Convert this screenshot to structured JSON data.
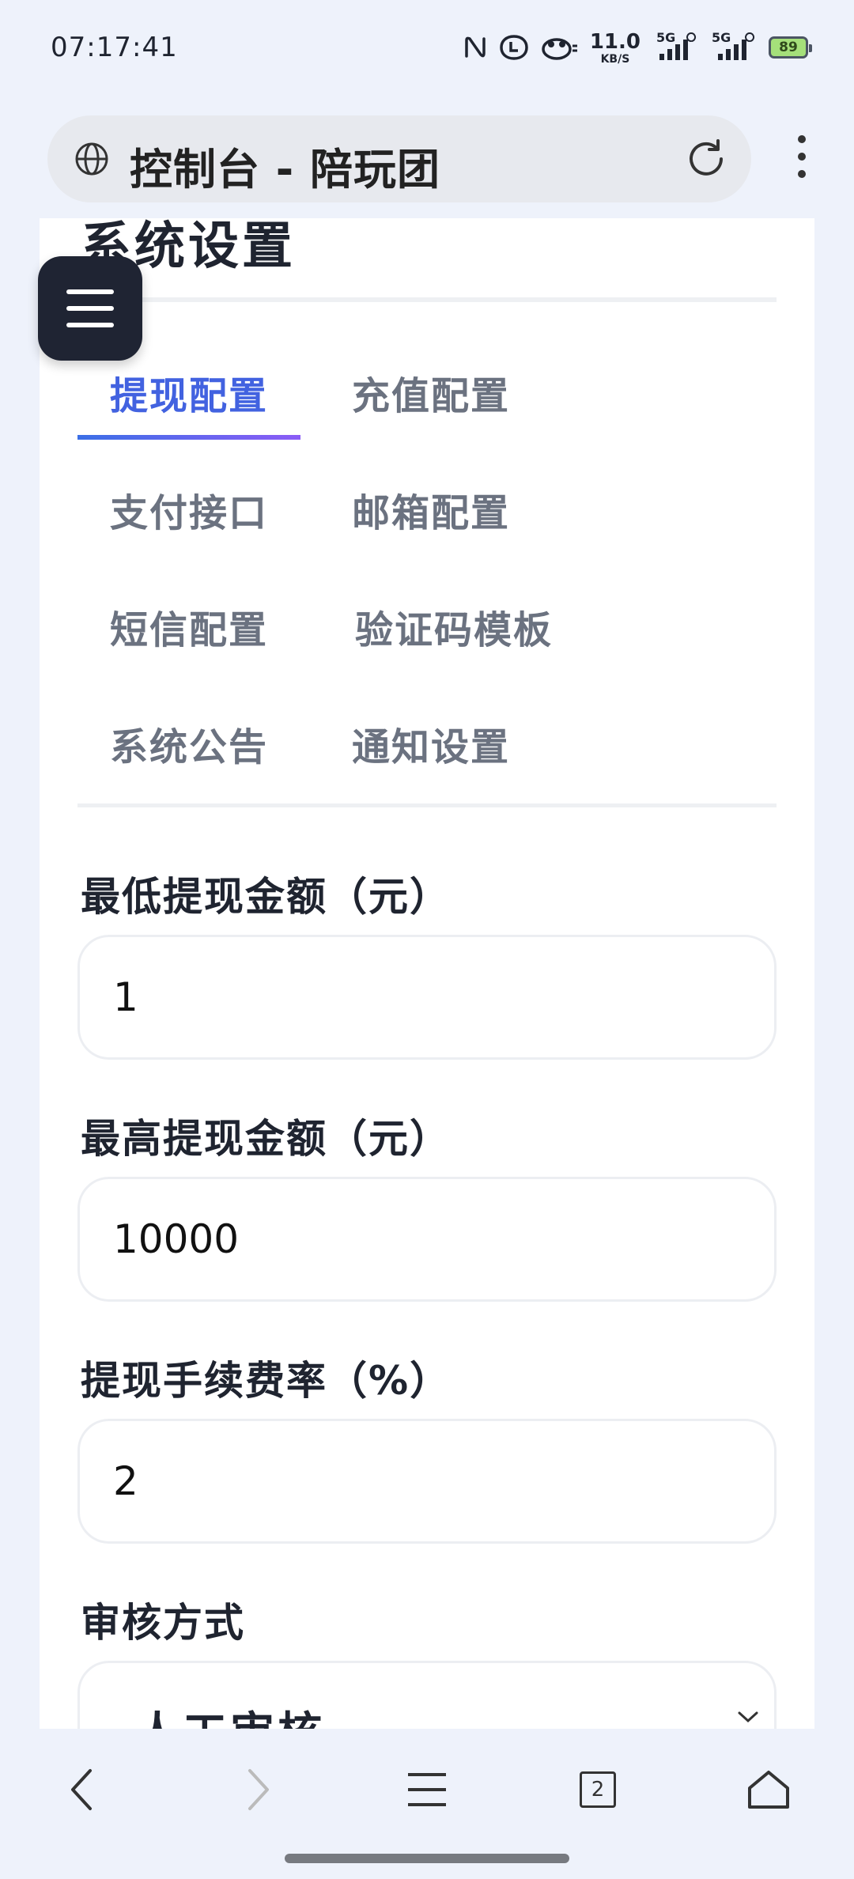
{
  "status_bar": {
    "time": "07:17:41",
    "net_speed_value": "11.0",
    "net_speed_unit": "KB/S",
    "net_type_1": "5G",
    "net_type_2": "5G",
    "battery": "89"
  },
  "browser": {
    "title": "控制台 - 陪玩团",
    "tab_count": "2"
  },
  "page": {
    "title": "系统设置"
  },
  "tabs": [
    {
      "label": "提现配置",
      "active": true
    },
    {
      "label": "充值配置",
      "active": false
    },
    {
      "label": "支付接口",
      "active": false
    },
    {
      "label": "邮箱配置",
      "active": false
    },
    {
      "label": "短信配置",
      "active": false
    },
    {
      "label": "验证码模板",
      "active": false
    },
    {
      "label": "系统公告",
      "active": false
    },
    {
      "label": "通知设置",
      "active": false
    }
  ],
  "form": {
    "min_withdraw_label": "最低提现金额（元）",
    "min_withdraw_value": "1",
    "max_withdraw_label": "最高提现金额（元）",
    "max_withdraw_value": "10000",
    "fee_rate_label": "提现手续费率（%）",
    "fee_rate_value": "2",
    "review_method_label": "审核方式",
    "review_method_value": "人工审核"
  },
  "colors": {
    "accent": "#4262e0",
    "accent_gradient_end": "#8b5cf6",
    "menu_button": "#1f2433"
  }
}
